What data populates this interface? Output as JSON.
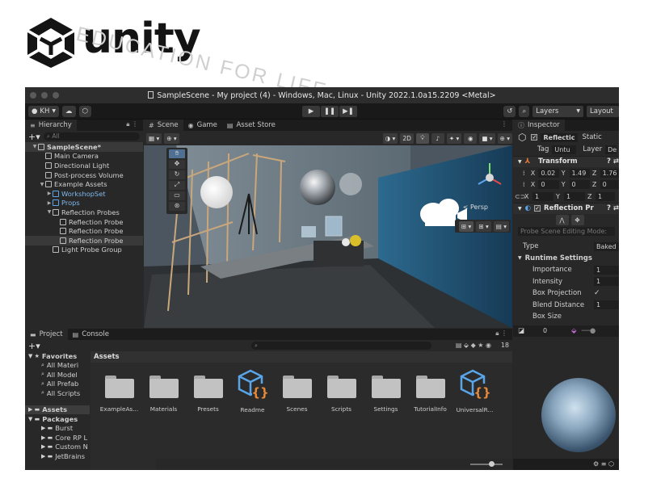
{
  "brand": {
    "logo_text": "unity",
    "watermark_text": "EDUCATION FOR LIFE"
  },
  "window": {
    "title": "SampleScene - My project (4) - Windows, Mac, Linux - Unity 2022.1.0a15.2209 <Metal>"
  },
  "toolbar": {
    "account": "KH",
    "layers_label": "Layers",
    "layout_label": "Layout"
  },
  "hierarchy": {
    "tab_label": "Hierarchy",
    "search_placeholder": "All",
    "items": [
      {
        "label": "SampleScene*",
        "indent": 0,
        "arrow": "▼",
        "icon": "scene",
        "style": "hl"
      },
      {
        "label": "Main Camera",
        "indent": 1,
        "arrow": "",
        "icon": "cube"
      },
      {
        "label": "Directional Light",
        "indent": 1,
        "arrow": "",
        "icon": "cube"
      },
      {
        "label": "Post-process Volume",
        "indent": 1,
        "arrow": "",
        "icon": "cube"
      },
      {
        "label": "Example Assets",
        "indent": 1,
        "arrow": "▼",
        "icon": "cube"
      },
      {
        "label": "WorkshopSet",
        "indent": 2,
        "arrow": "▶",
        "icon": "cube-blue",
        "blue": true
      },
      {
        "label": "Props",
        "indent": 2,
        "arrow": "▶",
        "icon": "cube-blue",
        "blue": true
      },
      {
        "label": "Reflection Probes",
        "indent": 2,
        "arrow": "▼",
        "icon": "cube"
      },
      {
        "label": "Reflection Probe",
        "indent": 3,
        "arrow": "",
        "icon": "cube"
      },
      {
        "label": "Reflection Probe",
        "indent": 3,
        "arrow": "",
        "icon": "cube"
      },
      {
        "label": "Reflection Probe",
        "indent": 3,
        "arrow": "",
        "icon": "cube",
        "style": "hl"
      },
      {
        "label": "Light Probe Group",
        "indent": 2,
        "arrow": "",
        "icon": "cube"
      }
    ]
  },
  "scene_view": {
    "tabs": [
      {
        "label": "Scene",
        "icon": "#"
      },
      {
        "label": "Game",
        "icon": "◉"
      },
      {
        "label": "Asset Store",
        "icon": "▤"
      }
    ],
    "mode_2d": "2D",
    "persp_label": "< Persp"
  },
  "inspector": {
    "tab_label": "Inspector",
    "object_name": "Reflectic",
    "static_label": "Static",
    "tag_label": "Tag",
    "tag_value": "Untu",
    "layer_label": "Layer",
    "layer_value": "De",
    "transform_label": "Transform",
    "position": {
      "x": "0.02",
      "y": "1.49",
      "z": "1.76"
    },
    "rotation": {
      "x": "0",
      "y": "0",
      "z": "0"
    },
    "scale": {
      "x": "1",
      "y": "1",
      "z": "1"
    },
    "component_label": "Reflection Pr",
    "editing_mode_label": "Probe Scene Editing Mode:",
    "type_label": "Type",
    "type_value": "Baked",
    "runtime_label": "Runtime Settings",
    "importance_label": "Importance",
    "importance_value": "1",
    "intensity_label": "Intensity",
    "intensity_value": "1",
    "box_projection_label": "Box Projection",
    "blend_distance_label": "Blend Distance",
    "blend_distance_value": "1",
    "box_size_label": "Box Size",
    "preview_value": "0"
  },
  "project": {
    "tabs": [
      {
        "label": "Project",
        "icon": "▬"
      },
      {
        "label": "Console",
        "icon": "▤"
      }
    ],
    "hidden_count": "18",
    "favorites_label": "Favorites",
    "favorites": [
      "All Materi",
      "All Model",
      "All Prefab",
      "All Scripts"
    ],
    "assets_label": "Assets",
    "packages_label": "Packages",
    "packages": [
      "Burst",
      "Core RP L",
      "Custom N",
      "JetBrains"
    ],
    "breadcrumb": "Assets",
    "items": [
      {
        "label": "ExampleAs...",
        "kind": "folder"
      },
      {
        "label": "Materials",
        "kind": "folder"
      },
      {
        "label": "Presets",
        "kind": "folder"
      },
      {
        "label": "Readme",
        "kind": "script"
      },
      {
        "label": "Scenes",
        "kind": "folder"
      },
      {
        "label": "Scripts",
        "kind": "folder"
      },
      {
        "label": "Settings",
        "kind": "folder"
      },
      {
        "label": "TutorialInfo",
        "kind": "folder"
      },
      {
        "label": "UniversalR...",
        "kind": "script"
      }
    ]
  },
  "colors": {
    "editor_bg": "#282828",
    "selection_blue": "#4f6f93",
    "asset_icon_blue": "#5aa5e8",
    "asset_icon_orange": "#e58a3a"
  }
}
